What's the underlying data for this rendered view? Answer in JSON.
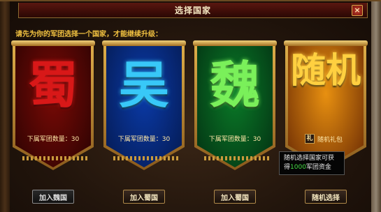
{
  "window": {
    "title": "选择国家",
    "close_label": "×"
  },
  "instruction": "请先为你的军团选择一个国家，才能继续升级：",
  "banners": [
    {
      "glyph": "蜀",
      "count_label": "下属军团数量：30",
      "color": "#d81818",
      "bg_top": "#7a0a06",
      "bg_bottom": "#2a0302"
    },
    {
      "glyph": "吴",
      "count_label": "下属军团数量：30",
      "color": "#38c8f8",
      "bg_top": "#0a3aa8",
      "bg_bottom": "#051a50"
    },
    {
      "glyph": "魏",
      "count_label": "下属军团数量：30",
      "color": "#7af05a",
      "bg_top": "#0a7a28",
      "bg_bottom": "#033012"
    },
    {
      "glyph": "随机",
      "color": "#ffd040",
      "bg_top": "#e89010",
      "bg_bottom": "#6a2a04"
    }
  ],
  "gift": {
    "icon_text": "礼",
    "label": "随机礼包"
  },
  "tooltip": {
    "line1": "随机选择国家可获",
    "line2_prefix": "得",
    "line2_amount": "1000",
    "line2_suffix": "军团资金"
  },
  "buttons": [
    {
      "label": "加入魏国"
    },
    {
      "label": "加入蜀国"
    },
    {
      "label": "加入蜀国"
    },
    {
      "label": "随机选择"
    }
  ]
}
